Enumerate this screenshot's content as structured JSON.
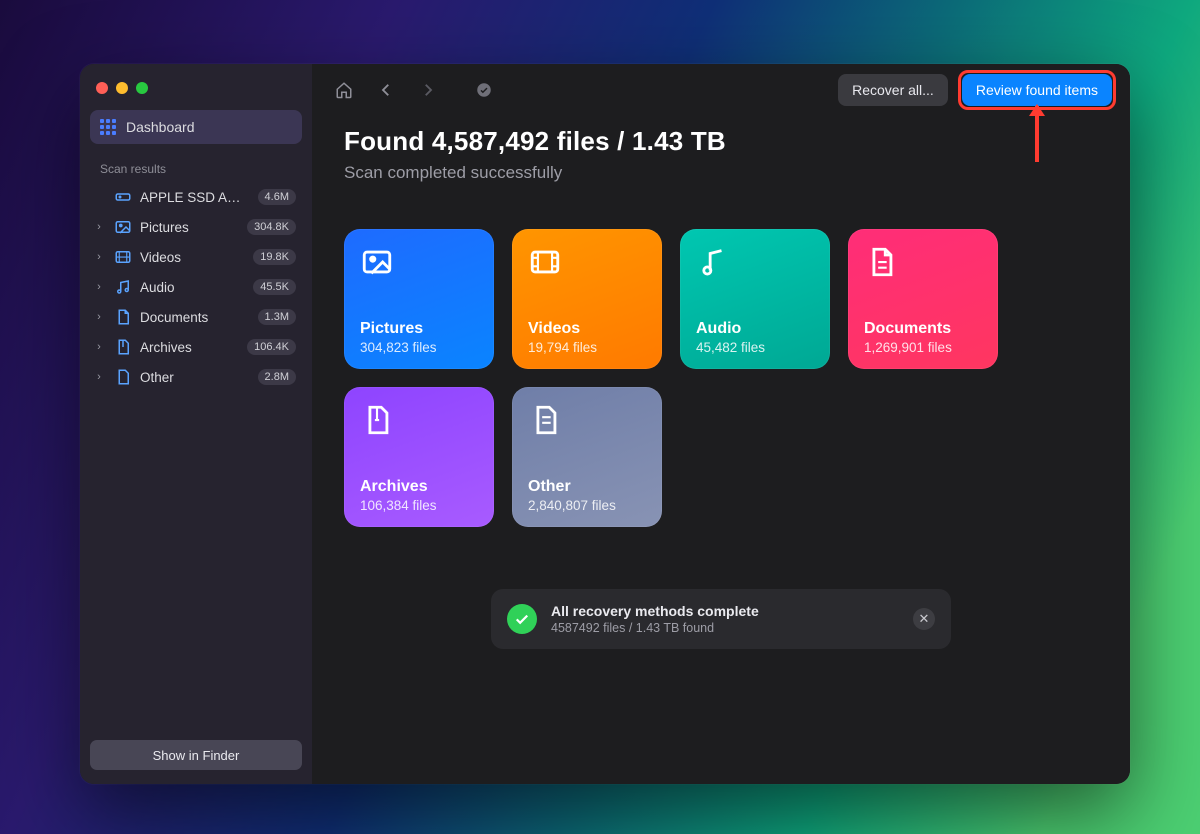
{
  "sidebar": {
    "dashboard_label": "Dashboard",
    "section_label": "Scan results",
    "drive": {
      "label": "APPLE SSD AP0…",
      "count": "4.6M"
    },
    "items": [
      {
        "icon": "image",
        "label": "Pictures",
        "count": "304.8K"
      },
      {
        "icon": "video",
        "label": "Videos",
        "count": "19.8K"
      },
      {
        "icon": "audio",
        "label": "Audio",
        "count": "45.5K"
      },
      {
        "icon": "doc",
        "label": "Documents",
        "count": "1.3M"
      },
      {
        "icon": "archive",
        "label": "Archives",
        "count": "106.4K"
      },
      {
        "icon": "other",
        "label": "Other",
        "count": "2.8M"
      }
    ],
    "show_in_finder": "Show in Finder"
  },
  "toolbar": {
    "recover_all": "Recover all...",
    "review": "Review found items"
  },
  "summary": {
    "headline": "Found 4,587,492 files / 1.43 TB",
    "subhead": "Scan completed successfully"
  },
  "cards": [
    {
      "key": "pictures",
      "title": "Pictures",
      "sub": "304,823 files"
    },
    {
      "key": "videos",
      "title": "Videos",
      "sub": "19,794 files"
    },
    {
      "key": "audio",
      "title": "Audio",
      "sub": "45,482 files"
    },
    {
      "key": "documents",
      "title": "Documents",
      "sub": "1,269,901 files"
    },
    {
      "key": "archives",
      "title": "Archives",
      "sub": "106,384 files"
    },
    {
      "key": "other",
      "title": "Other",
      "sub": "2,840,807 files"
    }
  ],
  "toast": {
    "title": "All recovery methods complete",
    "sub": "4587492 files / 1.43 TB found"
  }
}
